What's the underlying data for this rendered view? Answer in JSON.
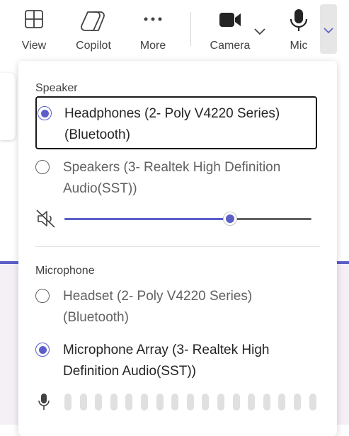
{
  "toolbar": {
    "view_label": "View",
    "copilot_label": "Copilot",
    "more_label": "More",
    "camera_label": "Camera",
    "mic_label": "Mic",
    "icons": {
      "view": "grid-icon",
      "copilot": "copilot-icon",
      "more": "more-horizontal-icon",
      "camera": "video-camera-icon",
      "camera_options": "chevron-down-icon",
      "mic": "microphone-icon",
      "mic_options": "chevron-down-icon"
    }
  },
  "speaker": {
    "title": "Speaker",
    "options": [
      {
        "label_line1": "Headphones (2- Poly V4220 Series)",
        "label_line2": "(Bluetooth)",
        "selected": true
      },
      {
        "label_line1": "Speakers (3- Realtek High Definition",
        "label_line2": "Audio(SST))",
        "selected": false
      }
    ],
    "volume_percent": 67,
    "mute_icon": "speaker-mute-icon"
  },
  "microphone": {
    "title": "Microphone",
    "options": [
      {
        "label_line1": "Headset (2- Poly V4220 Series)",
        "label_line2": "(Bluetooth)",
        "selected": false
      },
      {
        "label_line1": "Microphone Array (3- Realtek High",
        "label_line2": "Definition Audio(SST))",
        "selected": true
      }
    ],
    "level_bar_count": 17,
    "level_active_count": 0,
    "mic_icon": "microphone-icon"
  },
  "colors": {
    "accent": "#5b5fc7",
    "text": "#242424",
    "muted_text": "#616161"
  }
}
